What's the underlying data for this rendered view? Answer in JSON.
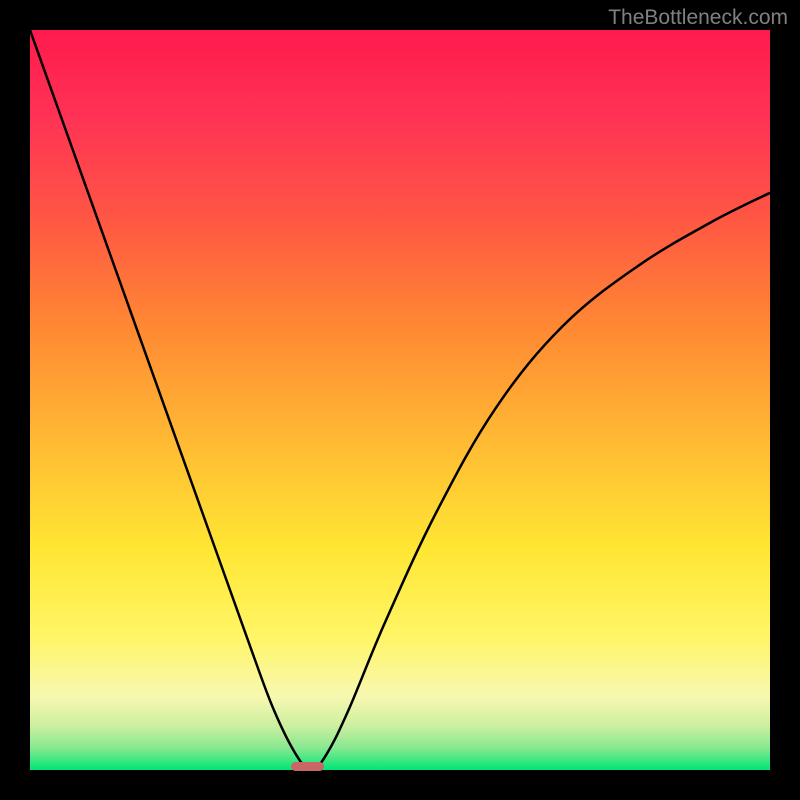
{
  "watermark": "TheBottleneck.com",
  "chart_data": {
    "type": "line",
    "title": "",
    "xlabel": "",
    "ylabel": "",
    "xlim": [
      0,
      100
    ],
    "ylim": [
      0,
      100
    ],
    "gradient_colors": {
      "top": "#ff1744",
      "upper_mid": "#ff6b35",
      "mid": "#ffa500",
      "lower_mid": "#ffeb3b",
      "lower": "#f5f5a0",
      "bottom": "#00e676"
    },
    "series": [
      {
        "name": "bottleneck-curve",
        "description": "V-shaped curve with minimum near x=38",
        "x": [
          0,
          5,
          10,
          15,
          20,
          25,
          30,
          33,
          36,
          38,
          40,
          43,
          48,
          55,
          63,
          72,
          82,
          92,
          100
        ],
        "y": [
          100,
          86,
          72,
          58,
          44,
          30,
          16,
          8,
          2,
          0,
          2,
          8,
          20,
          35,
          49,
          60,
          68,
          74,
          78
        ]
      }
    ],
    "marker": {
      "x": 37.5,
      "y": 0.5,
      "width": 4.5,
      "height": 1.2,
      "color": "#cc6666"
    }
  }
}
